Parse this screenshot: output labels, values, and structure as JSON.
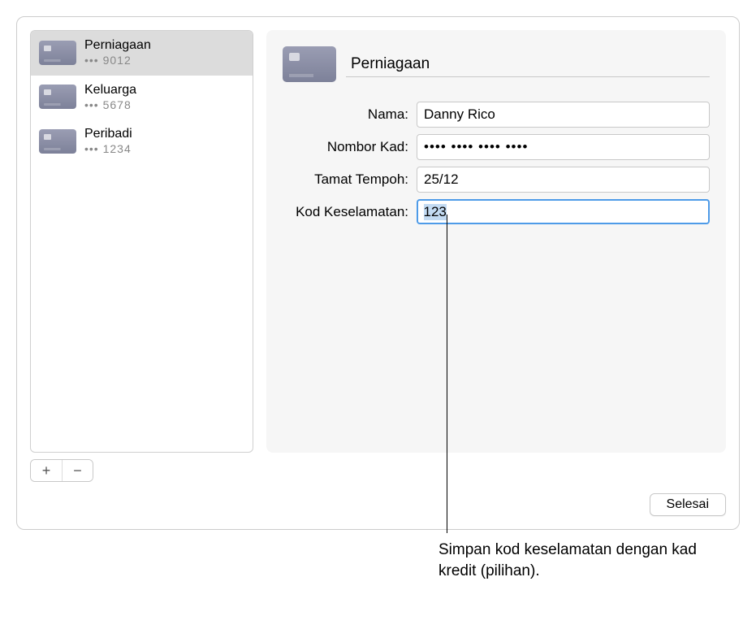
{
  "sidebar": {
    "items": [
      {
        "title": "Perniagaan",
        "masked": "••• 9012",
        "selected": true
      },
      {
        "title": "Keluarga",
        "masked": "••• 5678",
        "selected": false
      },
      {
        "title": "Peribadi",
        "masked": "••• 1234",
        "selected": false
      }
    ]
  },
  "controls": {
    "add": "+",
    "remove": "−"
  },
  "detail": {
    "title_value": "Perniagaan",
    "labels": {
      "name": "Nama:",
      "card_number": "Nombor Kad:",
      "expiry": "Tamat Tempoh:",
      "security_code": "Kod Keselamatan:"
    },
    "values": {
      "name": "Danny Rico",
      "card_number": "•••• •••• •••• ••••",
      "expiry": "25/12",
      "security_code": "123"
    }
  },
  "footer": {
    "done": "Selesai"
  },
  "callout": {
    "text": "Simpan kod keselamatan dengan kad kredit (pilihan)."
  }
}
